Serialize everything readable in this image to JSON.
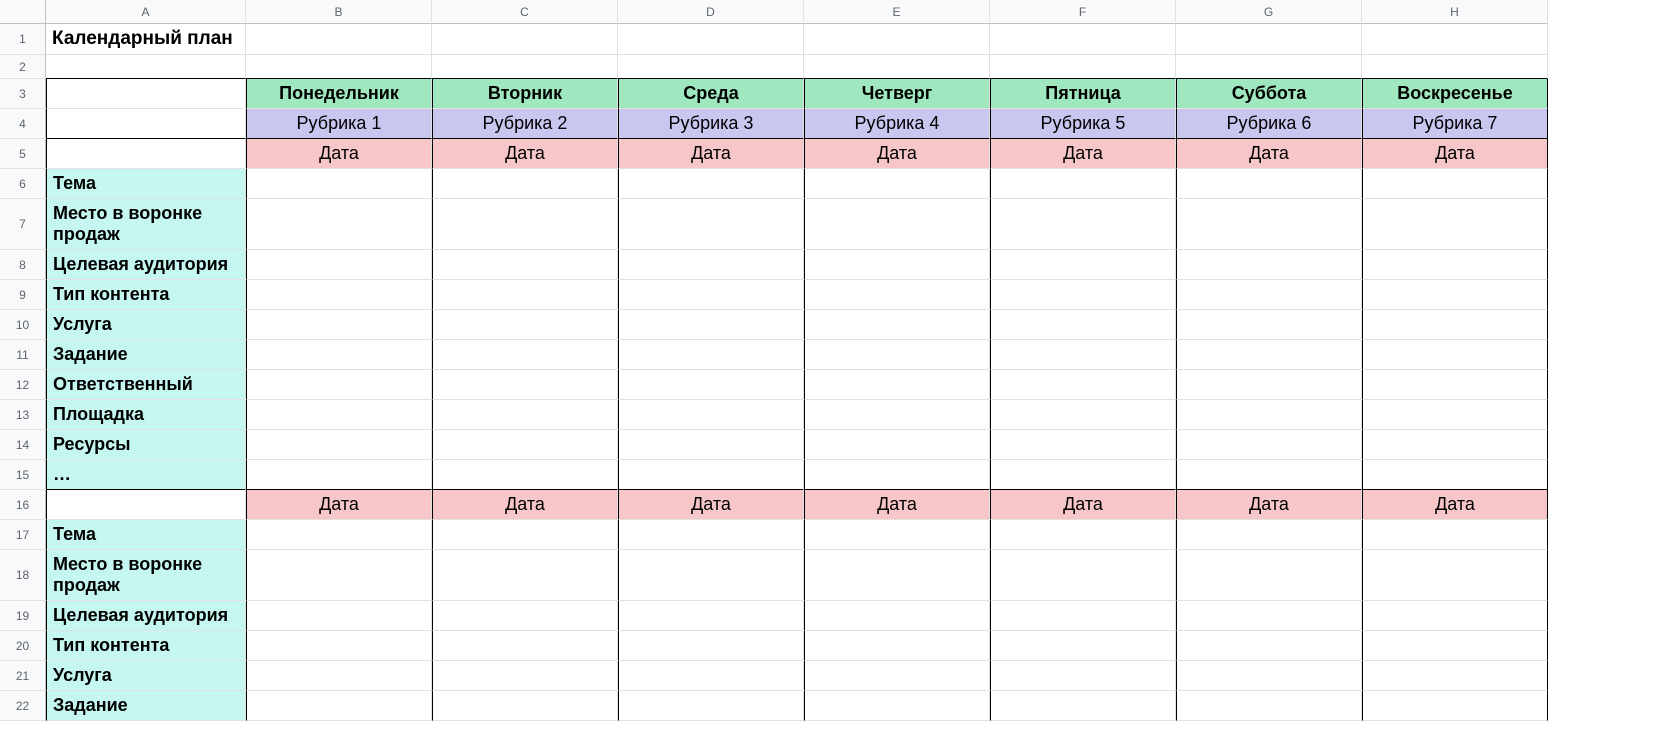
{
  "columns": [
    "A",
    "B",
    "C",
    "D",
    "E",
    "F",
    "G",
    "H"
  ],
  "rowCount": 22,
  "title": "Календарный план",
  "days": [
    "Понедельник",
    "Вторник",
    "Среда",
    "Четверг",
    "Пятница",
    "Суббота",
    "Воскресенье"
  ],
  "rubrics": [
    "Рубрика 1",
    "Рубрика 2",
    "Рубрика 3",
    "Рубрика 4",
    "Рубрика 5",
    "Рубрика 6",
    "Рубрика 7"
  ],
  "dateLabel": "Дата",
  "fields": [
    "Тема",
    "Место в воронке продаж",
    "Целевая аудитория",
    "Тип контента",
    "Услуга",
    "Задание",
    "Ответственный",
    "Площадка",
    "Ресурсы",
    "…"
  ],
  "fields2": [
    "Тема",
    "Место в воронке продаж",
    "Целевая аудитория",
    "Тип контента",
    "Услуга",
    "Задание"
  ]
}
